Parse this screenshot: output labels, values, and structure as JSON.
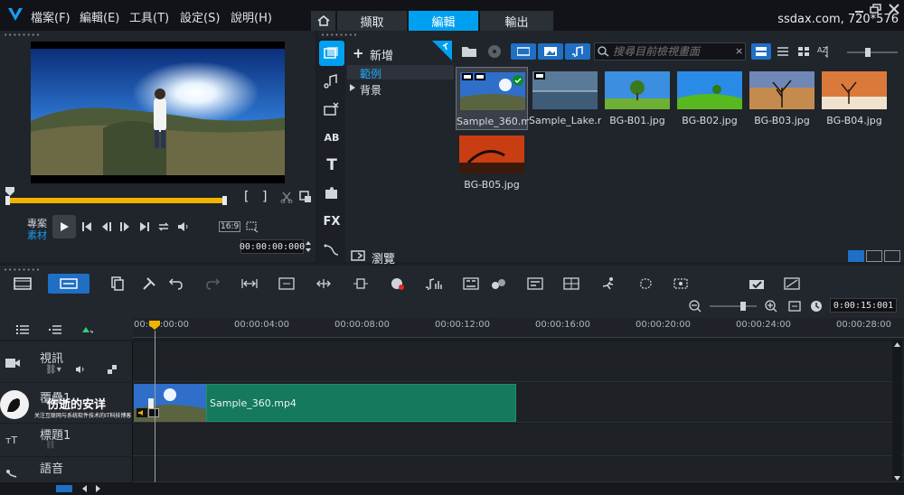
{
  "menu": {
    "file": "檔案(F)",
    "edit": "編輯(E)",
    "tools": "工具(T)",
    "settings": "設定(S)",
    "help": "說明(H)"
  },
  "tabs": {
    "capture": "擷取",
    "edit": "編輯",
    "output": "輸出"
  },
  "resolution_label": "ssdax.com, 720*576",
  "player": {
    "mode_project": "專案",
    "mode_clip": "素材",
    "bracket_in": "[",
    "bracket_out": "]",
    "aspect": "16:9",
    "timecode": "00:00:00:000"
  },
  "library": {
    "add_label": "新增",
    "tree": [
      "範例",
      "背景"
    ],
    "browse_label": "瀏覽",
    "search_placeholder": "搜尋目前檢視畫面",
    "thumbnails": [
      {
        "label": "Sample_360.m..."
      },
      {
        "label": "Sample_Lake.m..."
      },
      {
        "label": "BG-B01.jpg"
      },
      {
        "label": "BG-B02.jpg"
      },
      {
        "label": "BG-B03.jpg"
      },
      {
        "label": "BG-B04.jpg"
      },
      {
        "label": "BG-B05.jpg"
      }
    ],
    "side_icons": [
      "media-icon",
      "music-note-icon",
      "transition-icon",
      "ab-title-icon",
      "title-t-icon",
      "puzzle-icon",
      "fx-text-icon",
      "path-icon"
    ],
    "fx_label": "FX",
    "ab_label": "AB",
    "t_label": "T"
  },
  "timeline": {
    "timecode": "0:00:15:001",
    "ruler": [
      "00:00:00:00",
      "00:00:04:00",
      "00:00:08:00",
      "00:00:12:00",
      "00:00:16:00",
      "00:00:20:00",
      "00:00:24:00",
      "00:00:28:00"
    ],
    "tracks": [
      {
        "name": "視訊"
      },
      {
        "name": "覆疊1"
      },
      {
        "name": "標題1"
      },
      {
        "name": "語音"
      }
    ],
    "clip_label": "Sample_360.mp4"
  },
  "watermark": {
    "title": "伤逝的安详",
    "subtitle": "关注互联网与系统软件技术的IT科技博客"
  },
  "colors": {
    "accent": "#00a0f0",
    "clip_green": "#157a5d",
    "background": "#1b1e24"
  }
}
